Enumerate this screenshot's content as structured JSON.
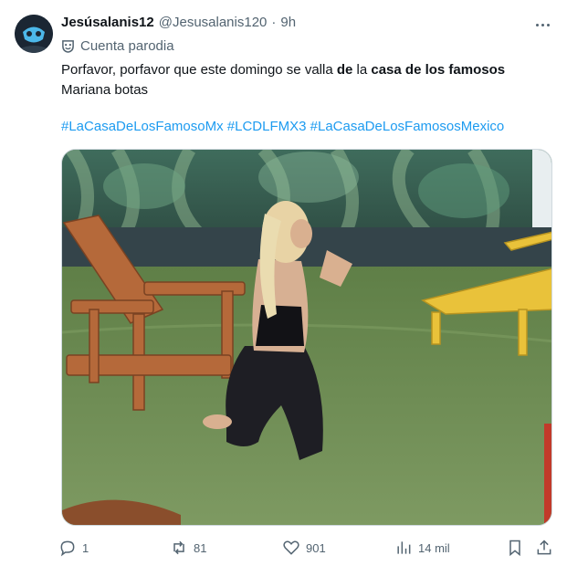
{
  "post": {
    "author": {
      "display_name": "Jesúsalanis12",
      "handle": "@Jesusalanis120",
      "separator": "·",
      "time": "9h",
      "badge_text": "Cuenta parodia",
      "avatar_icon": "avatar-image",
      "badge_icon": "parody-mask-icon"
    },
    "text": {
      "part1": "Porfavor, porfavor que este domingo se valla ",
      "bold1": "de",
      "part2": " la ",
      "bold2": "casa de los famosos",
      "line2": "Mariana botas"
    },
    "hashtags": [
      "#LaCasaDeLosFamosoMx",
      "#LCDLFMX3",
      "#LaCasaDeLosFamososMexico"
    ],
    "media": {
      "type": "image",
      "icon": "gif-image"
    },
    "stats": {
      "replies": "1",
      "reposts": "81",
      "likes": "901",
      "views": "14 mil"
    },
    "colors": {
      "accent": "#1d9bf0",
      "secondary_text": "#536471",
      "text": "#0f1419"
    }
  }
}
